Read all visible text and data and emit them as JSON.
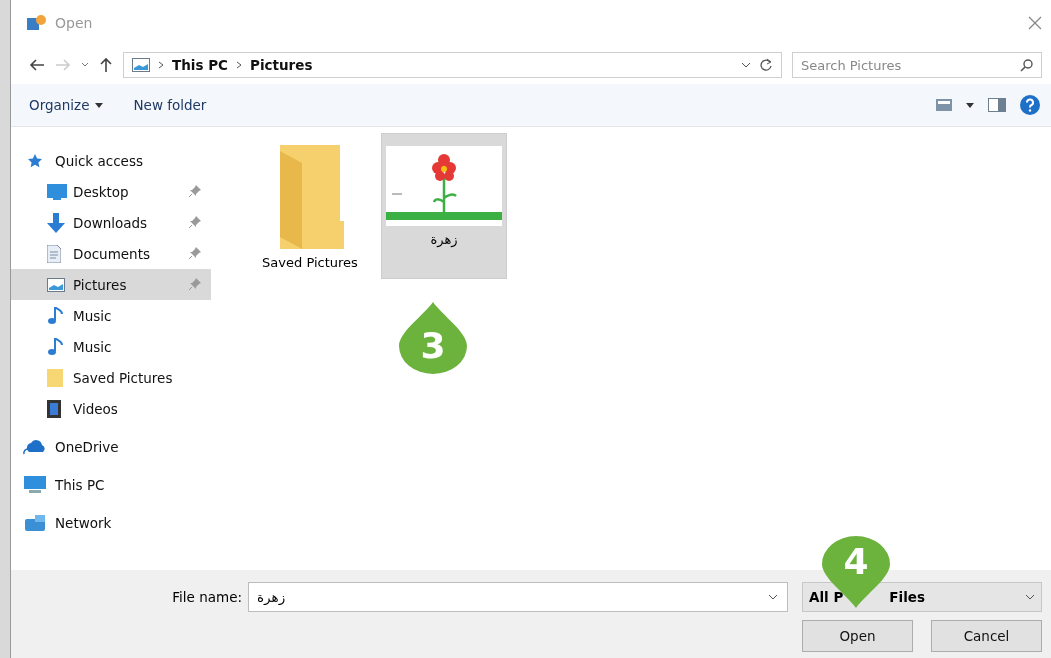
{
  "window": {
    "title": "Open"
  },
  "address": {
    "path": [
      "This PC",
      "Pictures"
    ],
    "search_placeholder": "Search Pictures"
  },
  "toolbar": {
    "organize": "Organize",
    "new_folder": "New folder"
  },
  "nav": [
    {
      "label": "Quick access",
      "selected": false,
      "children": [
        {
          "label": "Desktop",
          "pinned": true,
          "selected": false
        },
        {
          "label": "Downloads",
          "pinned": true,
          "selected": false
        },
        {
          "label": "Documents",
          "pinned": true,
          "selected": false
        },
        {
          "label": "Pictures",
          "pinned": true,
          "selected": true
        },
        {
          "label": "Music",
          "pinned": false,
          "selected": false
        },
        {
          "label": "Music",
          "pinned": false,
          "selected": false
        },
        {
          "label": "Saved Pictures",
          "pinned": false,
          "selected": false
        },
        {
          "label": "Videos",
          "pinned": false,
          "selected": false
        }
      ]
    },
    {
      "label": "OneDrive",
      "selected": false
    },
    {
      "label": "This PC",
      "selected": false
    },
    {
      "label": "Network",
      "selected": false
    }
  ],
  "files": [
    {
      "name": "Saved Pictures",
      "kind": "folder",
      "selected": false
    },
    {
      "name": "زهرة",
      "kind": "image",
      "selected": true
    }
  ],
  "footer": {
    "file_name_label": "File name:",
    "file_name": "زهرة",
    "file_type_start": "All P",
    "file_type_end": "Files",
    "buttons": [
      "Open",
      "Cancel"
    ]
  },
  "step_markers": [
    {
      "number": "3"
    },
    {
      "number": "4"
    }
  ]
}
